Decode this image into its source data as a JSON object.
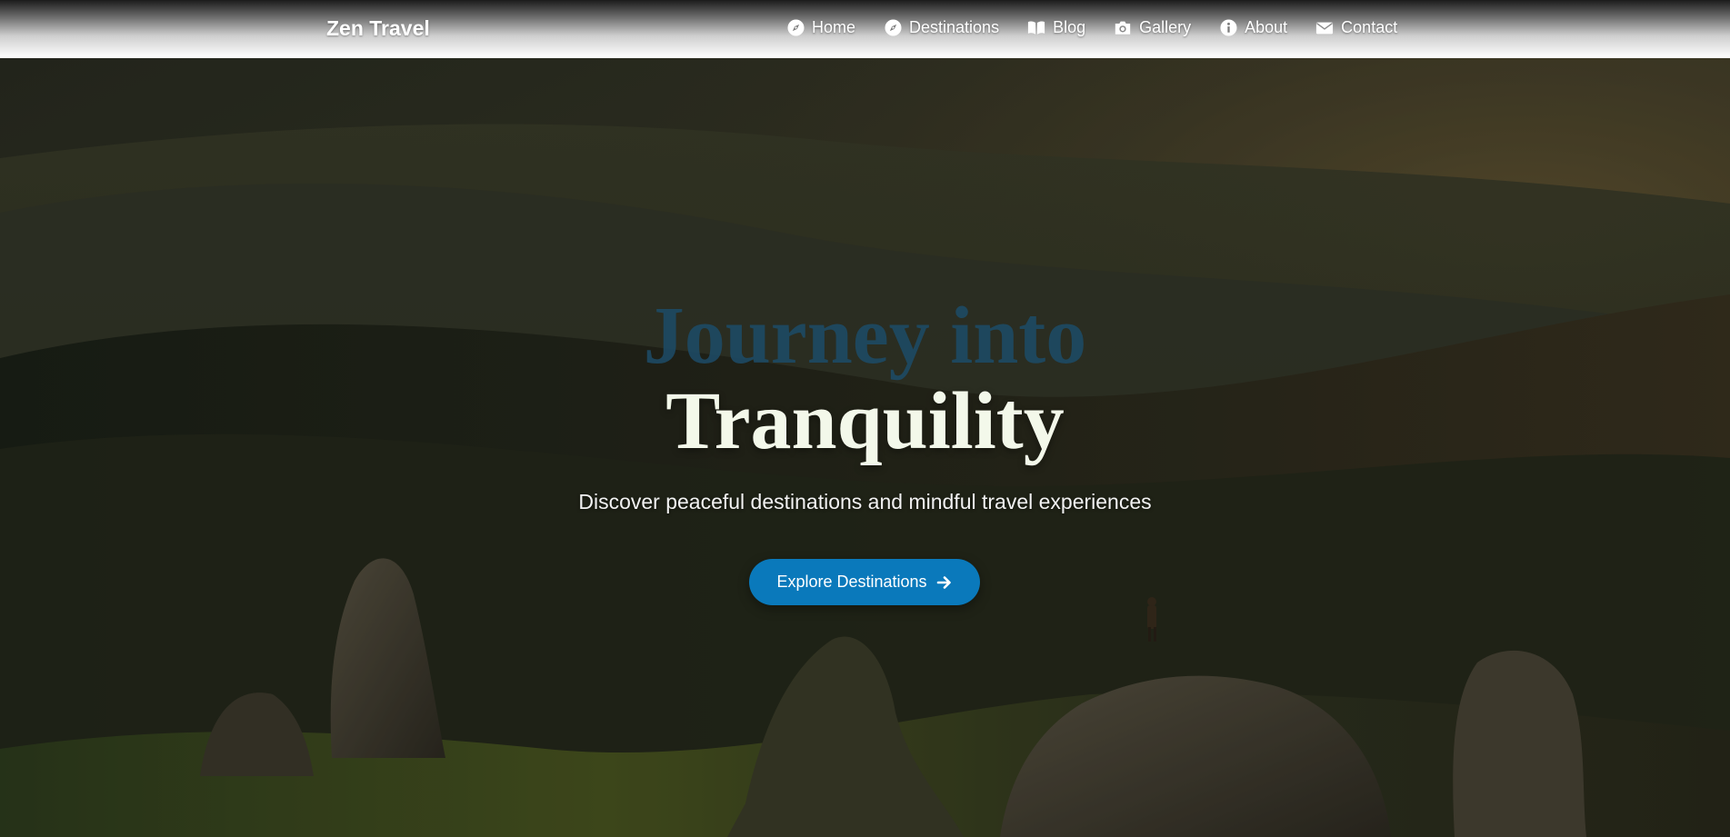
{
  "brand": "Zen Travel",
  "nav": {
    "items": [
      {
        "label": "Home",
        "icon": "compass-icon"
      },
      {
        "label": "Destinations",
        "icon": "compass-icon"
      },
      {
        "label": "Blog",
        "icon": "book-icon"
      },
      {
        "label": "Gallery",
        "icon": "camera-icon"
      },
      {
        "label": "About",
        "icon": "info-icon"
      },
      {
        "label": "Contact",
        "icon": "envelope-icon"
      }
    ]
  },
  "hero": {
    "title_line1": "Journey into",
    "title_line2": "Tranquility",
    "subtitle": "Discover peaceful destinations and mindful travel experiences",
    "cta_label": "Explore Destinations",
    "cta_icon": "arrow-right-icon"
  },
  "colors": {
    "accent": "#0a79bb",
    "title_dark": "#1d4a64",
    "title_light": "#f3f8ea"
  }
}
